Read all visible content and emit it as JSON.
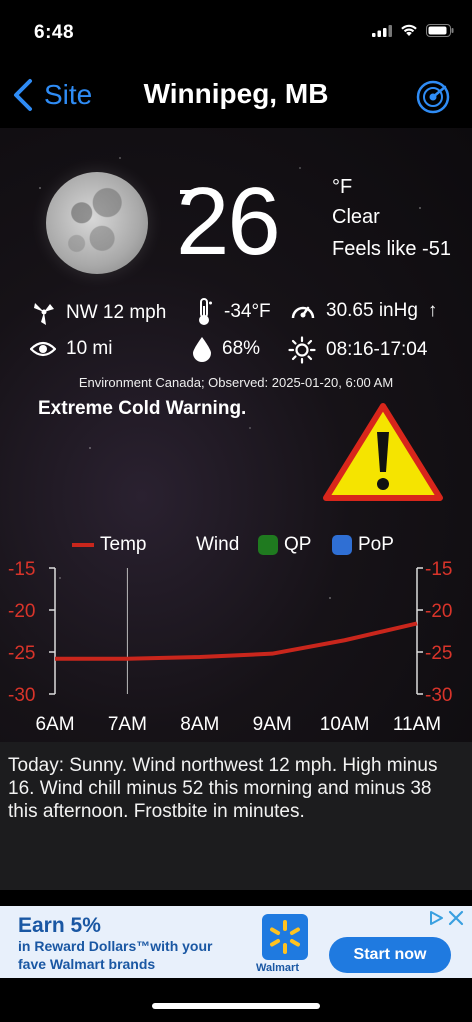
{
  "status_bar": {
    "time": "6:48"
  },
  "nav": {
    "back_label": "Site",
    "title": "Winnipeg, MB",
    "radar_icon": "radar-icon"
  },
  "current": {
    "temperature": "26",
    "unit": "°F",
    "condition": "Clear",
    "feels_like": "Feels like -51",
    "wind": "NW 12 mph",
    "dewpoint": "-34°F",
    "pressure": "30.65 inHg",
    "pressure_trend": "↑",
    "visibility": "10 mi",
    "humidity": "68%",
    "sun": "08:16-17:04"
  },
  "observed": "Environment Canada; Observed: 2025-01-20, 6:00 AM",
  "warning": {
    "text": "Extreme Cold Warning."
  },
  "legend": {
    "temp": "Temp",
    "wind": "Wind",
    "qp": "QP",
    "pop": "PoP",
    "temp_color": "#c9261c",
    "qp_color": "#1f7a1f",
    "pop_color": "#2f6fd4"
  },
  "chart_data": {
    "type": "line",
    "x": [
      "6AM",
      "7AM",
      "8AM",
      "9AM",
      "10AM",
      "11AM"
    ],
    "series": [
      {
        "name": "Temp",
        "values": [
          -25.8,
          -25.8,
          -25.6,
          -25.2,
          -23.6,
          -21.6
        ]
      }
    ],
    "yticks": [
      "-15",
      "-20",
      "-25",
      "-30"
    ],
    "ylim": [
      -30,
      -15
    ],
    "current_time_marker": "7AM"
  },
  "forecast_text": "Today:  Sunny. Wind northwest 12 mph. High minus 16. Wind chill minus 52 this morning and minus 38 this afternoon. Frostbite in minutes.",
  "ad": {
    "line1": "Earn 5%",
    "line2": "in Reward Dollars™with your",
    "line3": "fave Walmart brands",
    "brand": "Walmart",
    "cta": "Start now"
  }
}
